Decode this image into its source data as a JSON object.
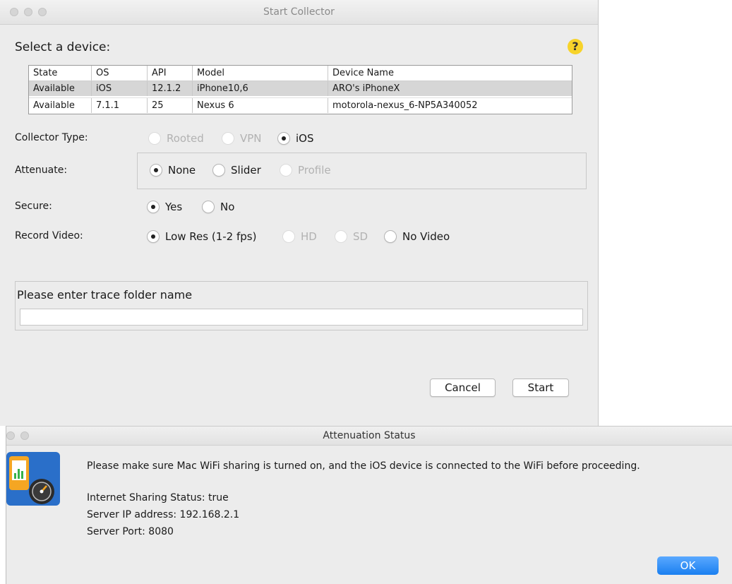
{
  "collector": {
    "title": "Start Collector",
    "select_label": "Select a device:",
    "help": "?",
    "table": {
      "columns": [
        "State",
        "OS",
        "API",
        "Model",
        "Device Name"
      ],
      "rows": [
        [
          "Available",
          "iOS",
          "12.1.2",
          "iPhone10,6",
          "ARO's iPhoneX"
        ],
        [
          "Available",
          "7.1.1",
          "25",
          "Nexus 6",
          "motorola-nexus_6-NP5A340052"
        ]
      ],
      "selected_row": 0
    },
    "collector_type": {
      "label": "Collector Type:",
      "options": [
        "Rooted",
        "VPN",
        "iOS"
      ],
      "selected": "iOS"
    },
    "attenuate": {
      "label": "Attenuate:",
      "options": [
        "None",
        "Slider",
        "Profile"
      ],
      "selected": "None"
    },
    "secure": {
      "label": "Secure:",
      "options": [
        "Yes",
        "No"
      ],
      "selected": "Yes"
    },
    "record_video": {
      "label": "Record Video:",
      "options": [
        "Low Res (1-2 fps)",
        "HD",
        "SD",
        "No Video"
      ],
      "selected": "Low Res (1-2 fps)"
    },
    "trace": {
      "label": "Please enter trace folder name",
      "value": ""
    },
    "cancel_label": "Cancel",
    "start_label": "Start"
  },
  "attenuation": {
    "title": "Attenuation Status",
    "message": "Please make sure Mac WiFi sharing is turned on, and the iOS device is connected to the WiFi before proceeding.",
    "sharing_status": "Internet Sharing Status:  true",
    "server_ip": "Server IP address:  192.168.2.1",
    "server_port": "Server Port: 8080",
    "ok_label": "OK"
  },
  "colors": {
    "window_bg": "#ececec",
    "selected_row": "#d6d6d6",
    "help_icon": "#f7d32a",
    "ok_button": "#1a7ff0",
    "app_icon_orange": "#f5a623",
    "app_icon_blue": "#2a6fc9"
  }
}
